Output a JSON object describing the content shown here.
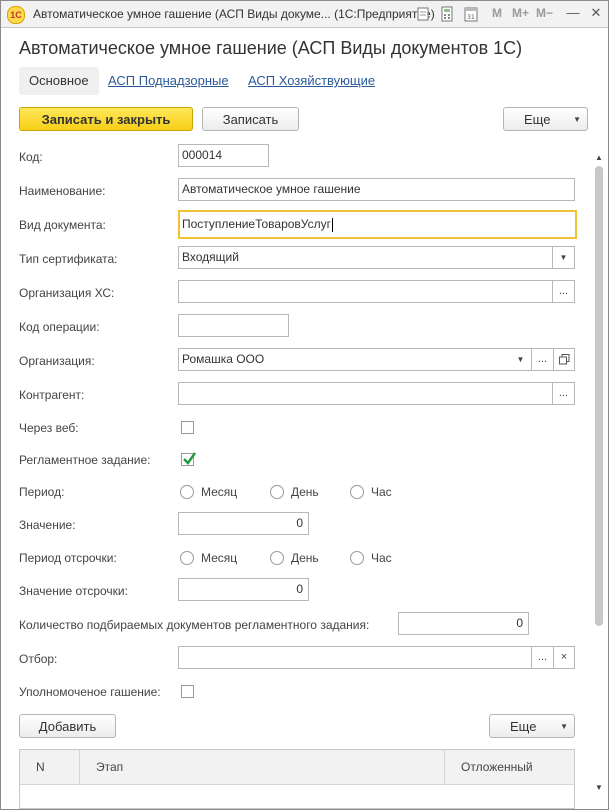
{
  "window": {
    "title": "Автоматическое умное гашение (АСП Виды докуме... (1С:Предприятие)",
    "logo_text": "1С",
    "toolbar": {
      "m": "M",
      "m_plus": "M+",
      "m_minus": "M−"
    },
    "controls": {
      "minimize": "—",
      "maximize": "☐",
      "close": "✕"
    }
  },
  "form": {
    "title": "Автоматическое умное гашение (АСП Виды документов 1С)",
    "tabs": [
      {
        "label": "Основное"
      },
      {
        "label": "АСП Поднадзорные"
      },
      {
        "label": "АСП Хозяйствующие"
      }
    ],
    "commandbar": {
      "save_close": "Записать и закрыть",
      "save": "Записать",
      "more": "Еще"
    },
    "fields": {
      "code": {
        "label": "Код:",
        "value": "000014"
      },
      "name": {
        "label": "Наименование:",
        "value": "Автоматическое умное гашение"
      },
      "doc_type": {
        "label": "Вид документа:",
        "value": "ПоступлениеТоваровУслуг"
      },
      "cert_type": {
        "label": "Тип сертификата:",
        "value": "Входящий"
      },
      "org_hs": {
        "label": "Организация ХС:",
        "value": ""
      },
      "op_code": {
        "label": "Код операции:",
        "value": ""
      },
      "org": {
        "label": "Организация:",
        "value": "Ромашка ООО"
      },
      "counterparty": {
        "label": "Контрагент:",
        "value": ""
      },
      "via_web": {
        "label": "Через веб:",
        "checked": false
      },
      "scheduled": {
        "label": "Регламентное задание:",
        "checked": true
      },
      "period": {
        "label": "Период:",
        "options": [
          "Месяц",
          "День",
          "Час"
        ]
      },
      "value": {
        "label": "Значение:",
        "value": "0"
      },
      "delay_period": {
        "label": "Период отсрочки:",
        "options": [
          "Месяц",
          "День",
          "Час"
        ]
      },
      "delay_value": {
        "label": "Значение отсрочки:",
        "value": "0"
      },
      "docs_count": {
        "label": "Количество подбираемых документов регламентного задания:",
        "value": "0"
      },
      "filter": {
        "label": "Отбор:",
        "value": ""
      },
      "authorized": {
        "label": "Уполномоченое гашение:",
        "checked": false
      }
    },
    "table_bar": {
      "add": "Добавить",
      "more": "Еще"
    },
    "table": {
      "columns": [
        "N",
        "Этап",
        "Отложенный"
      ]
    }
  },
  "colors": {
    "accent": "#f7cf16",
    "link": "#2b5a9b",
    "check": "#1e9b3c",
    "focus": "#f1c232"
  }
}
